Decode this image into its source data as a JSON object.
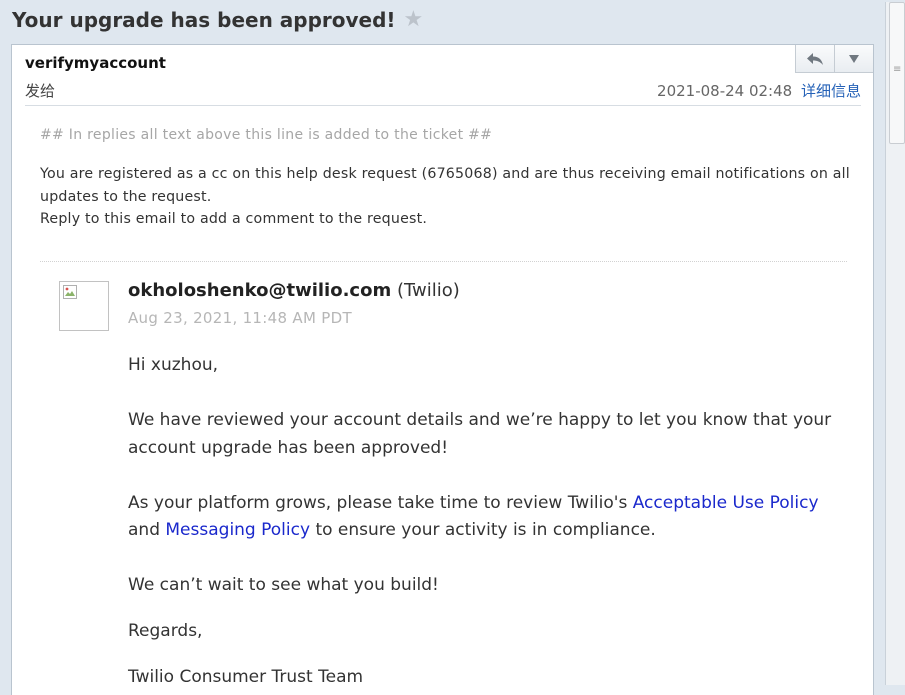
{
  "subject": "Your upgrade has been approved!",
  "star_icon": "star-icon",
  "header": {
    "from": "verifymyaccount",
    "to_label": "发给",
    "datetime": "2021-08-24 02:48",
    "details_link": "详细信息",
    "reply_icon": "reply-icon",
    "more_icon": "chevron-down-icon"
  },
  "ticket": {
    "reply_line": "## In replies all text above this line is added to the ticket ##",
    "notice_line1": "You are registered as a cc on this help desk request (6765068) and are thus receiving email notifications on all updates to the request.",
    "notice_line2": "Reply to this email to add a comment to the request."
  },
  "comment": {
    "sender_email": "okholoshenko@twilio.com",
    "sender_org": "(Twilio)",
    "date": "Aug 23, 2021, 11:48 AM PDT",
    "greeting": "Hi xuzhou,",
    "para1": "We have reviewed your account details and we’re happy to let you know that your account upgrade has been approved!",
    "para2_prefix": "As your platform grows, please take time to review Twilio's ",
    "link_aup": "Acceptable Use Policy",
    "para2_and": " and ",
    "link_msg": "Messaging Policy",
    "para2_suffix": " to ensure your activity is in compliance.",
    "para3": "We can’t wait to see what you build!",
    "regards": "Regards,",
    "signature": "Twilio Consumer Trust Team"
  },
  "colors": {
    "background": "#dfe7ef",
    "link_blue": "#1a28cc",
    "details_link": "#2461b7"
  }
}
